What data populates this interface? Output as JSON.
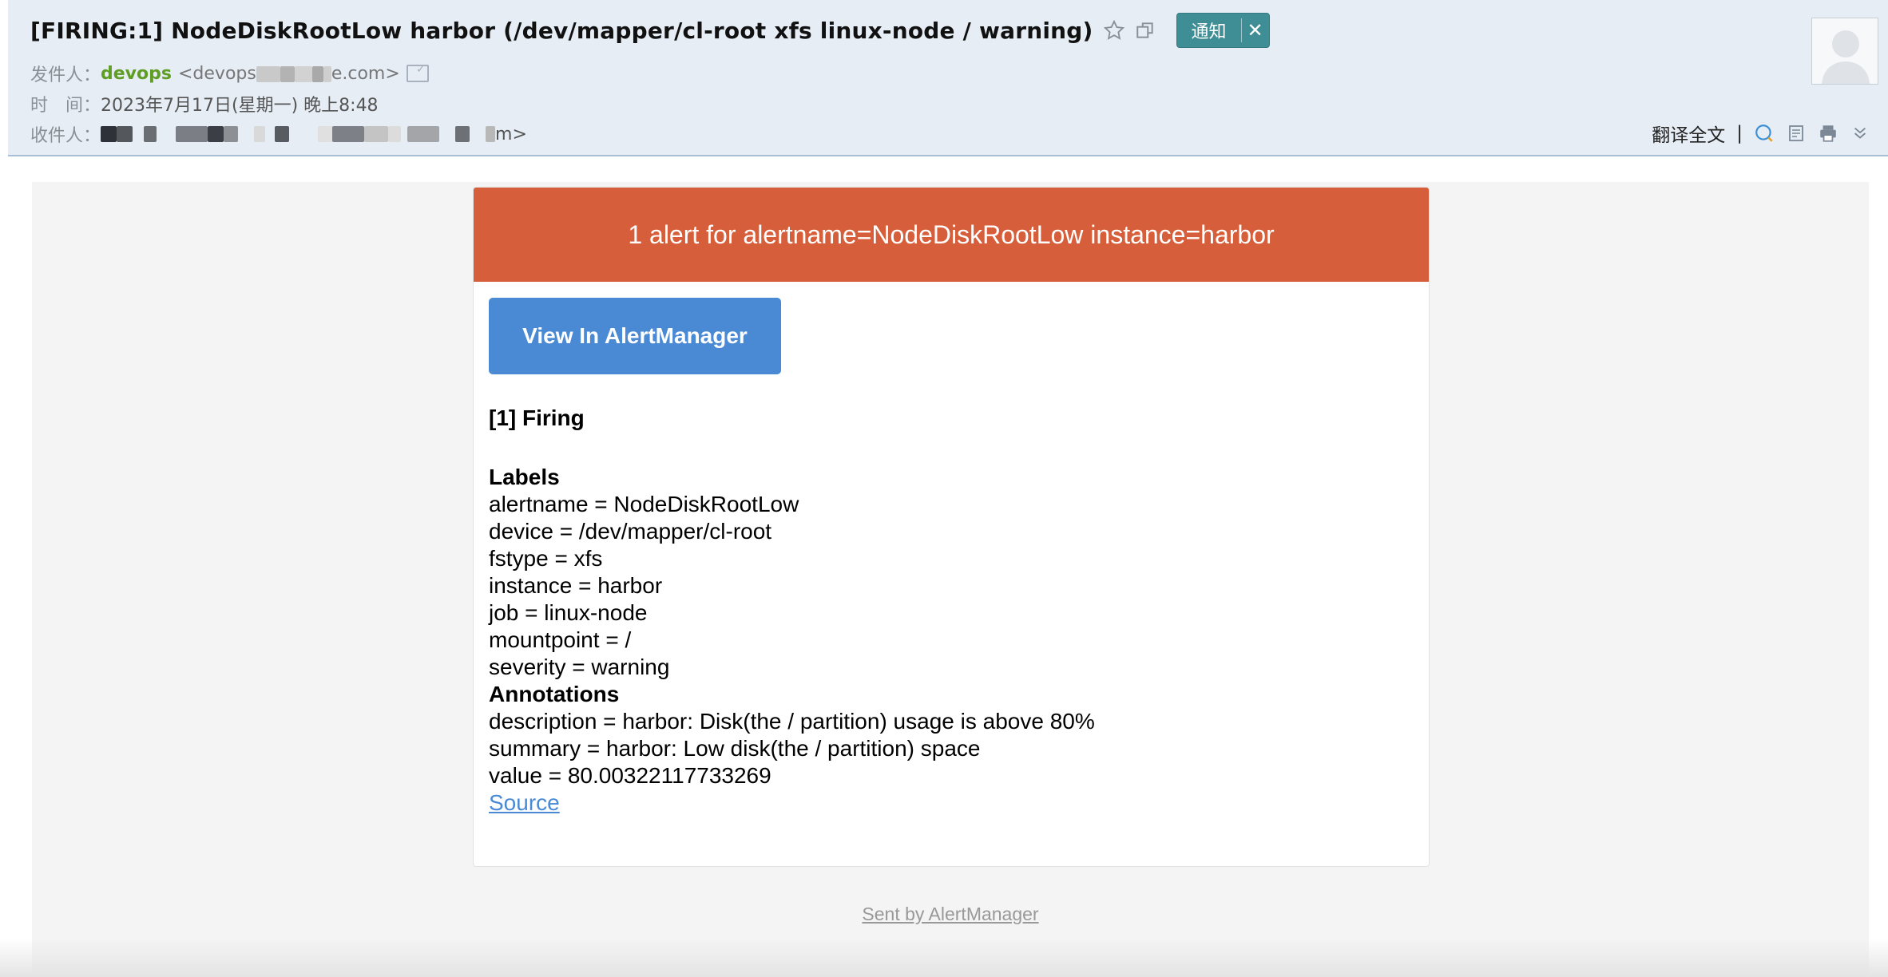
{
  "header": {
    "subject": "[FIRING:1] NodeDiskRootLow harbor (/dev/mapper/cl-root xfs linux-node / warning)",
    "tag_label": "通知",
    "tag_close": "✕",
    "from_label": "发件人：",
    "sender_name": "devops",
    "sender_addr_prefix": "<devops",
    "sender_addr_suffix": "e.com>",
    "time_label": "时　间：",
    "time_value": "2023年7月17日(星期一) 晚上8:48",
    "to_label": "收件人：",
    "to_suffix": "m>",
    "translate_label": "翻译全文",
    "tool_separator": "|"
  },
  "alert": {
    "banner": "1 alert for alertname=NodeDiskRootLow instance=harbor",
    "view_button": "View In AlertManager",
    "firing_title": "[1] Firing",
    "labels_title": "Labels",
    "labels": [
      "alertname = NodeDiskRootLow",
      "device = /dev/mapper/cl-root",
      "fstype = xfs",
      "instance = harbor",
      "job = linux-node",
      "mountpoint = /",
      "severity = warning"
    ],
    "annotations_title": "Annotations",
    "annotations": [
      "description = harbor: Disk(the / partition) usage is above 80%",
      "summary = harbor: Low disk(the / partition) space",
      "value = 80.00322117733269"
    ],
    "source_link": "Source"
  },
  "footer": {
    "sent_by": "Sent by AlertManager"
  },
  "colors": {
    "banner": "#d75e3b",
    "button": "#4a8ad4",
    "tag": "#3f8e96",
    "sender": "#5f9d24",
    "header_bg": "#e6edf5"
  },
  "icons": [
    "star-icon",
    "popout-icon",
    "close-icon",
    "verify-card-icon",
    "avatar-icon",
    "translate-icon",
    "note-icon",
    "print-icon",
    "expand-icon"
  ]
}
